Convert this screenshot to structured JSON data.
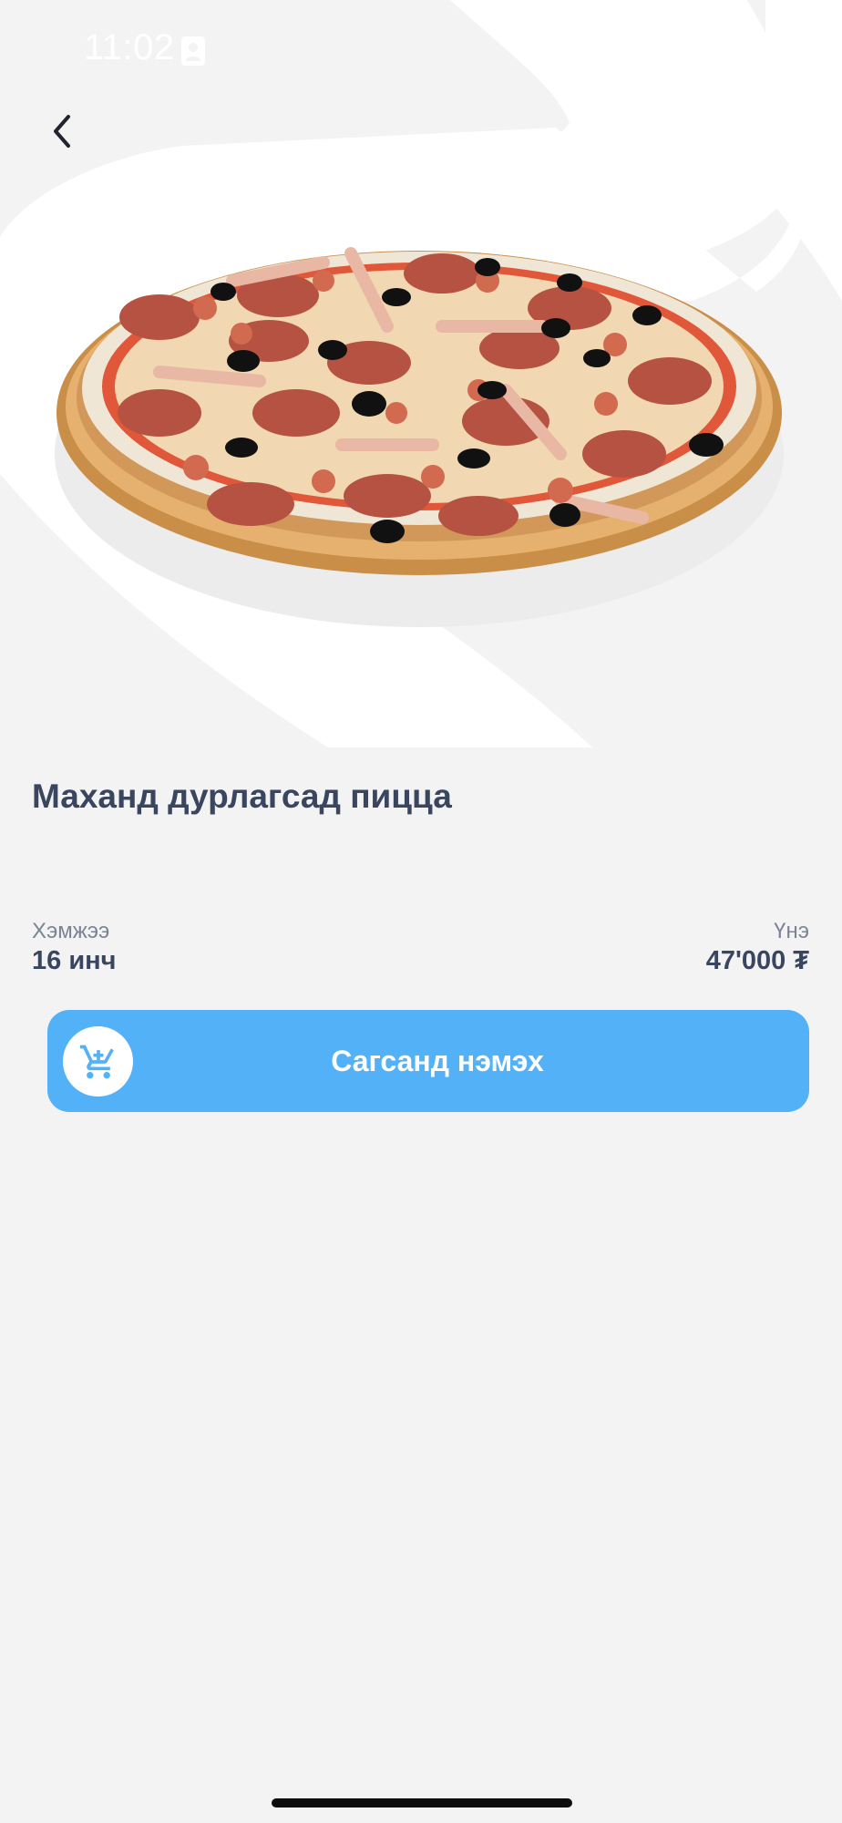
{
  "status_bar": {
    "time": "11:02"
  },
  "product": {
    "title": "Маханд дурлагсад пицца",
    "size_label": "Хэмжээ",
    "size_value": "16 инч",
    "price_label": "Үнэ",
    "price_value": "47'000 ₮"
  },
  "actions": {
    "add_to_cart_label": "Сагсанд нэмэх"
  },
  "icons": {
    "back": "chevron-left-icon",
    "cart": "cart-icon",
    "status_person": "person-badge-icon"
  },
  "colors": {
    "background": "#f3f3f3",
    "accent": "#53b1f7",
    "title_text": "#3a4660",
    "muted_text": "#7b8494"
  }
}
